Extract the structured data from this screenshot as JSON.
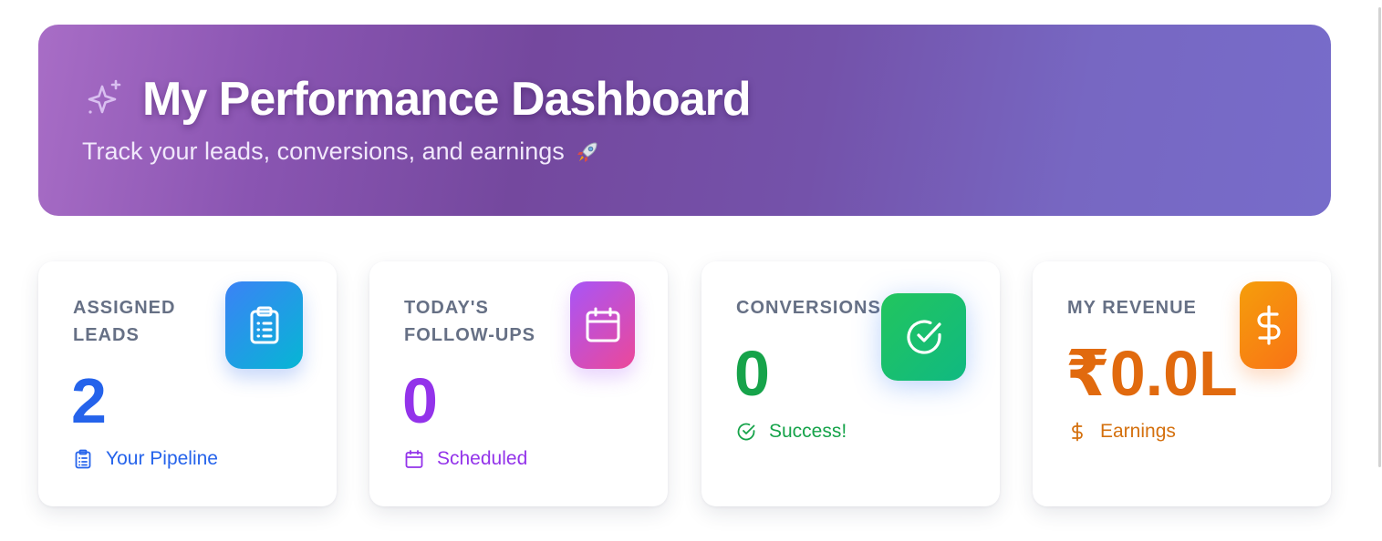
{
  "header": {
    "title": "My Performance Dashboard",
    "subtitle": "Track your leads, conversions, and earnings",
    "title_icon": "sparkles-icon",
    "subtitle_emoji": "rocket-icon"
  },
  "cards": [
    {
      "label": "Assigned Leads",
      "value": "2",
      "footer": "Your Pipeline",
      "icon": "clipboard-list-icon",
      "accent": "#2563eb"
    },
    {
      "label": "Today's Follow-ups",
      "value": "0",
      "footer": "Scheduled",
      "icon": "calendar-icon",
      "accent": "#9333ea"
    },
    {
      "label": "Conversions",
      "value": "0",
      "footer": "Success!",
      "icon": "check-circle-icon",
      "accent": "#16a34a"
    },
    {
      "label": "My Revenue",
      "value": "₹0.0L",
      "footer": "Earnings",
      "icon": "dollar-sign-icon",
      "accent": "#e16a0e"
    }
  ],
  "colors": {
    "hero_gradient_start": "#a86dc6",
    "hero_gradient_end": "#776cca",
    "blue": "#2563eb",
    "purple": "#9333ea",
    "green": "#16a34a",
    "orange": "#e16a0e"
  }
}
